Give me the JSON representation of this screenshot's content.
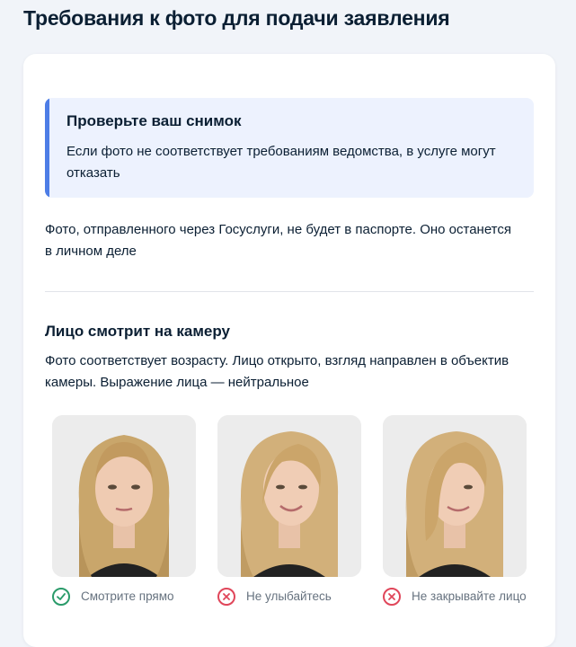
{
  "page": {
    "title": "Требования к фото для подачи заявления"
  },
  "alert": {
    "title": "Проверьте ваш снимок",
    "text": "Если фото не соответствует требованиям ведомства, в услуге могут отказать"
  },
  "info": {
    "text": "Фото, отправленного через Госуслуги, не будет в паспорте. Оно останется в личном деле"
  },
  "section": {
    "title": "Лицо смотрит на камеру",
    "text": "Фото соответствует возрасту. Лицо открыто, взгляд направлен в объектив камеры. Выражение лица — нейтральное"
  },
  "examples": [
    {
      "label": "Смотрите прямо",
      "status": "ok",
      "icon": "check-circle-icon"
    },
    {
      "label": "Не улыбайтесь",
      "status": "bad",
      "icon": "cross-circle-icon"
    },
    {
      "label": "Не закрывайте лицо",
      "status": "bad",
      "icon": "cross-circle-icon"
    }
  ],
  "colors": {
    "accent": "#4d7de6",
    "alert_bg": "#edf2fe",
    "ok": "#2a9b6a",
    "bad": "#e0465a",
    "text": "#0b1f33",
    "muted": "#66727f"
  }
}
